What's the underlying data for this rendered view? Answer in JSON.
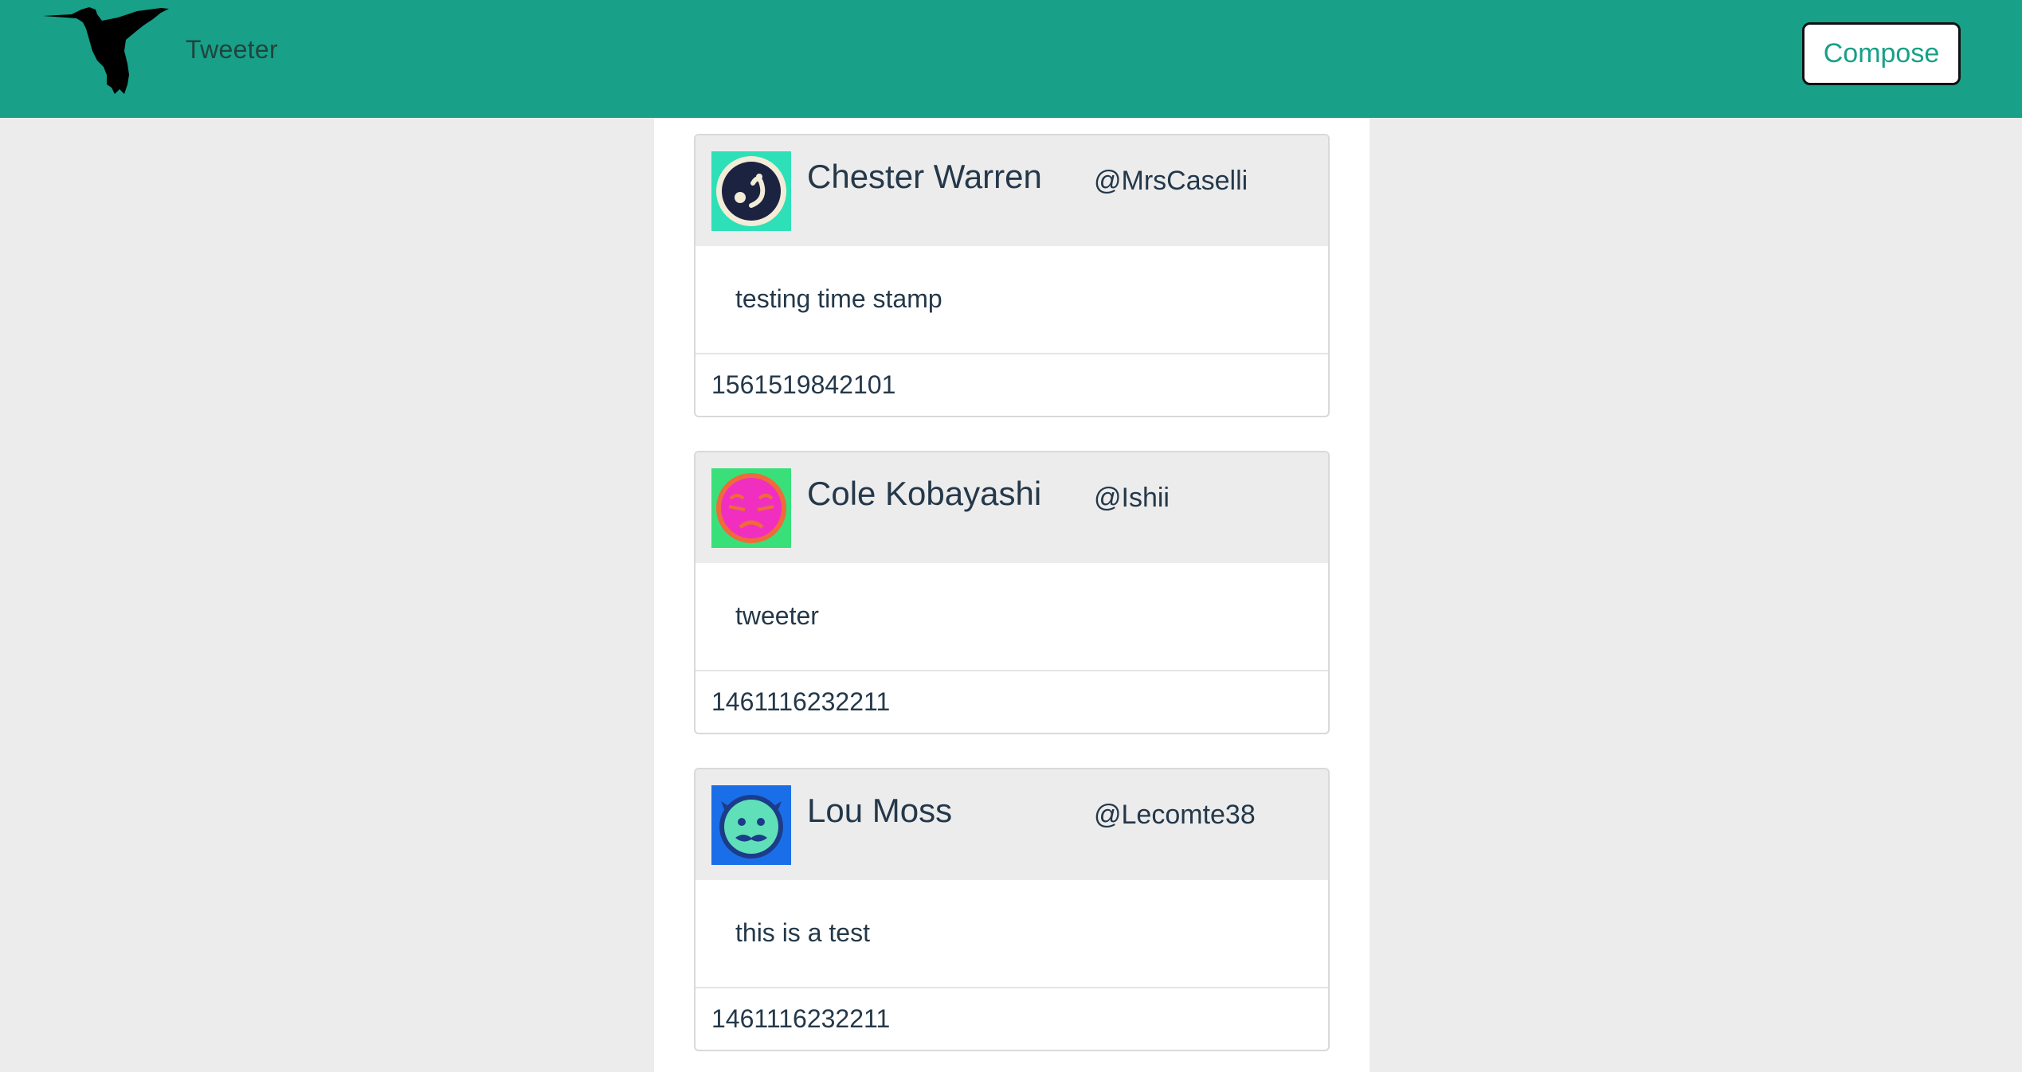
{
  "header": {
    "brand": "Tweeter",
    "compose_label": "Compose",
    "logo_icon": "hummingbird-icon",
    "bg_color": "#18a088"
  },
  "tweets": [
    {
      "name": "Chester Warren",
      "handle": "@MrsCaselli",
      "text": "testing time stamp",
      "timestamp": "1561519842101",
      "avatar_icon": "robot-avatar-icon",
      "avatar_bg": "#2ee0b8"
    },
    {
      "name": "Cole Kobayashi",
      "handle": "@Ishii",
      "text": "tweeter",
      "timestamp": "1461116232211",
      "avatar_icon": "robot-avatar-icon",
      "avatar_bg": "#39e07a"
    },
    {
      "name": "Lou Moss",
      "handle": "@Lecomte38",
      "text": "this is a test",
      "timestamp": "1461116232211",
      "avatar_icon": "robot-avatar-icon",
      "avatar_bg": "#1a6fe8"
    }
  ]
}
